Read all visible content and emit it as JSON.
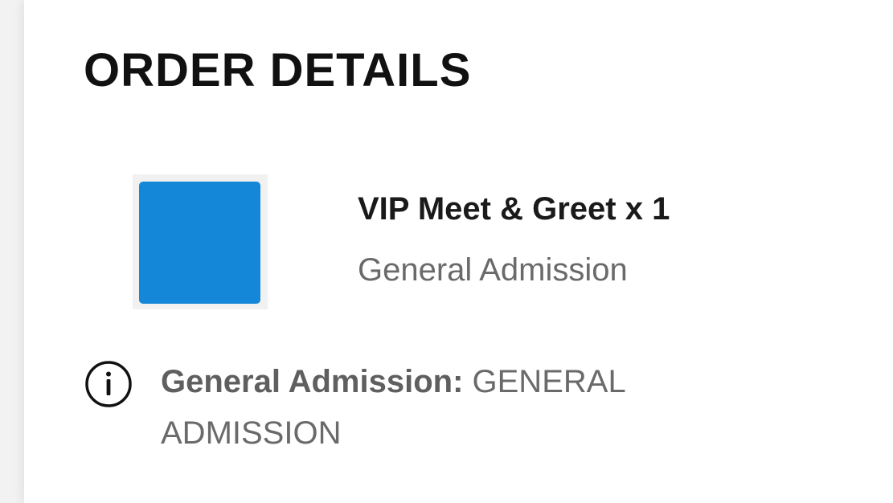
{
  "order": {
    "title": "ORDER DETAILS",
    "item": {
      "name": "VIP Meet & Greet x 1",
      "variant": "General Admission",
      "thumbnail_color": "#1487d8"
    },
    "info": {
      "icon": "info-circle-icon",
      "label": "General Admission:",
      "value": "GENERAL ADMISSION"
    }
  }
}
